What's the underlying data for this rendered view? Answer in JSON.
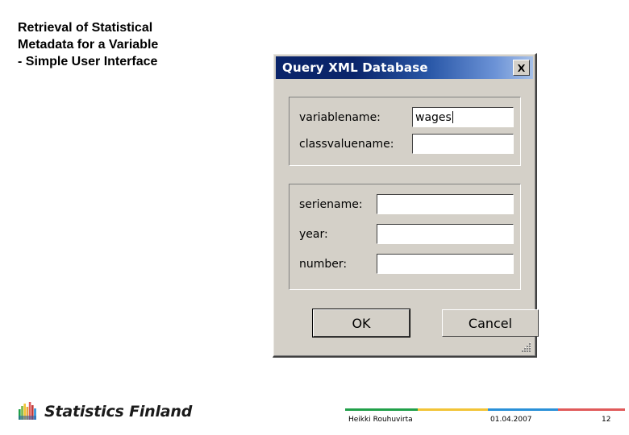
{
  "slide": {
    "title_lines": [
      "Retrieval of Statistical",
      "Metadata for a Variable",
      "- Simple User Interface"
    ]
  },
  "dialog": {
    "title": "Query XML Database",
    "close_icon": "close-icon",
    "groups": [
      {
        "name": "variable-group",
        "fields": [
          {
            "label": "variablename:",
            "value": "wages",
            "focused": true
          },
          {
            "label": "classvaluename:",
            "value": "",
            "focused": false
          }
        ]
      },
      {
        "name": "series-group",
        "fields": [
          {
            "label": "seriename:",
            "value": "",
            "focused": false
          },
          {
            "label": "year:",
            "value": "",
            "focused": false
          },
          {
            "label": "number:",
            "value": "",
            "focused": false
          }
        ]
      }
    ],
    "buttons": {
      "ok": "OK",
      "cancel": "Cancel"
    },
    "resize_grip_icon": "resize-grip-icon"
  },
  "footer": {
    "logo_text": "Statistics Finland",
    "author": "Heikki Rouhuvirta",
    "date": "01.04.2007",
    "page": "12",
    "bar_colors": [
      "#21a04a",
      "#f2c437",
      "#2a90d8",
      "#e05a5a"
    ]
  },
  "colors": {
    "dialog_face": "#d4d0c8",
    "titlebar_start": "#0a246a",
    "titlebar_end": "#a6c0e8"
  }
}
